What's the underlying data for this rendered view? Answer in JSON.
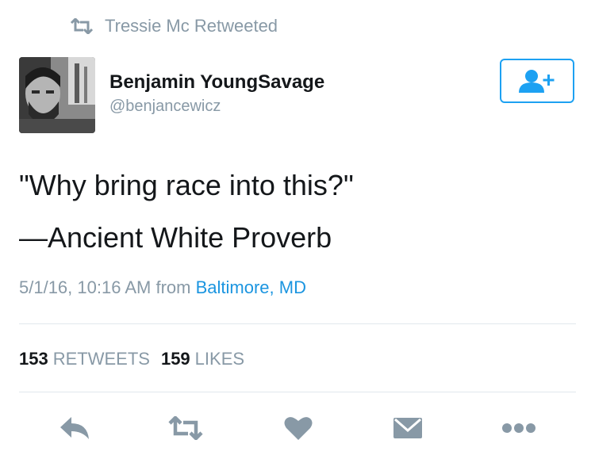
{
  "retweet_context": {
    "text": "Tressie Mc Retweeted",
    "icon": "retweet-icon"
  },
  "author": {
    "display_name": "Benjamin YoungSavage",
    "handle": "@benjancewicz"
  },
  "follow_button": {
    "icon": "follow-user-plus-icon",
    "accent": "#1da1f2"
  },
  "tweet": {
    "line1": "\"Why bring race into this?\"",
    "line2": "—Ancient White Proverb"
  },
  "meta": {
    "timestamp": "5/1/16, 10:16 AM",
    "from_label": "from",
    "location": "Baltimore, MD"
  },
  "stats": {
    "retweets_count": "153",
    "retweets_label": "RETWEETS",
    "likes_count": "159",
    "likes_label": "LIKES"
  },
  "actions": [
    "reply-icon",
    "retweet-icon",
    "like-heart-icon",
    "direct-message-icon",
    "more-icon"
  ],
  "colors": {
    "muted": "#8899a6",
    "link": "#1b95e0",
    "action": "#8899a6"
  }
}
